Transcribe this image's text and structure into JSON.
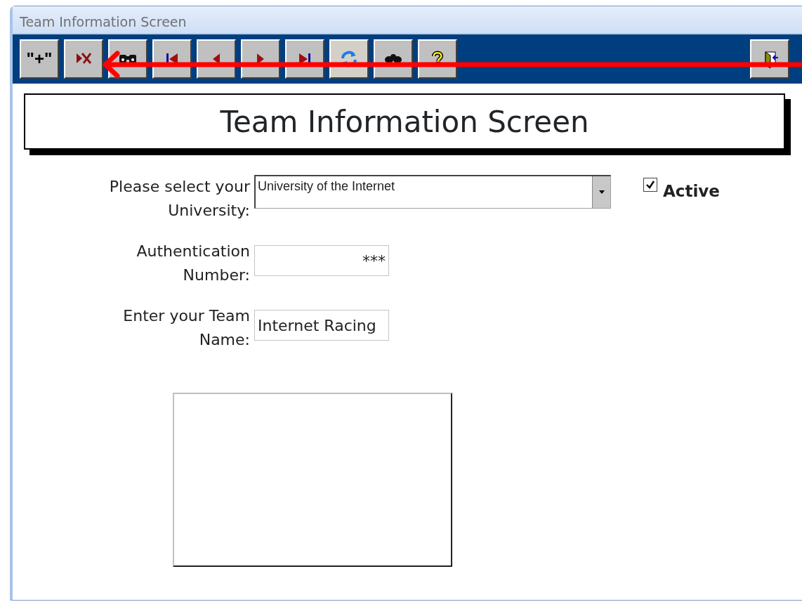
{
  "window": {
    "title": "Team Information Screen"
  },
  "toolbar": [
    {
      "kind": "text",
      "label": "\"+\""
    },
    {
      "kind": "delete"
    },
    {
      "kind": "find"
    },
    {
      "kind": "first"
    },
    {
      "kind": "previous"
    },
    {
      "kind": "next"
    },
    {
      "kind": "last"
    },
    {
      "kind": "refresh"
    },
    {
      "kind": "group"
    },
    {
      "kind": "help"
    }
  ],
  "exit_button": {
    "kind": "exit"
  },
  "heading": "Team Information Screen",
  "form": {
    "university": {
      "label": "Please select your University:",
      "value": "University of the Internet"
    },
    "active": {
      "label": "Active",
      "checked": true
    },
    "authentication": {
      "label": "Authentication Number:",
      "value": "***"
    },
    "team_name": {
      "label": "Enter your Team Name:",
      "value": "Internet Racing"
    }
  },
  "annotation": {
    "kind": "arrow"
  }
}
